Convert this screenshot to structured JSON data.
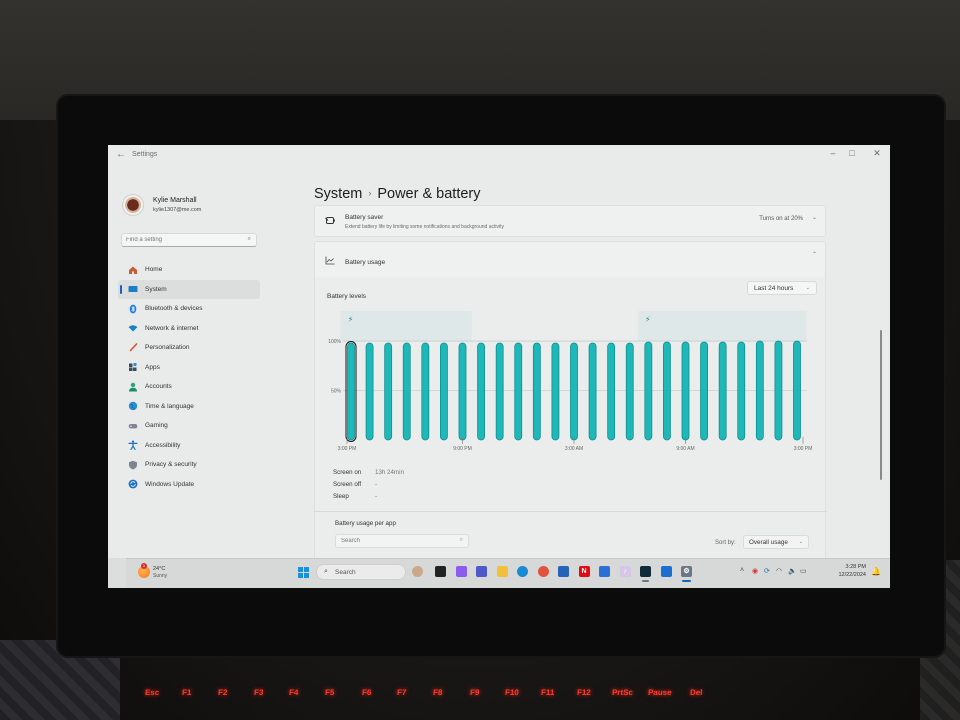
{
  "window": {
    "app_title": "Settings",
    "back_icon": "back-arrow-icon",
    "controls": {
      "minimize": "–",
      "maximize": "□",
      "close": "✕"
    }
  },
  "profile": {
    "name": "Kylie Marshall",
    "email": "kylie1307@me.com"
  },
  "search": {
    "placeholder": "Find a setting"
  },
  "sidebar": {
    "items": [
      {
        "label": "Home",
        "icon": "home-icon",
        "active": false
      },
      {
        "label": "System",
        "icon": "system-icon",
        "active": true
      },
      {
        "label": "Bluetooth & devices",
        "icon": "bluetooth-icon",
        "active": false
      },
      {
        "label": "Network & internet",
        "icon": "wifi-icon",
        "active": false
      },
      {
        "label": "Personalization",
        "icon": "brush-icon",
        "active": false
      },
      {
        "label": "Apps",
        "icon": "apps-icon",
        "active": false
      },
      {
        "label": "Accounts",
        "icon": "accounts-icon",
        "active": false
      },
      {
        "label": "Time & language",
        "icon": "globe-icon",
        "active": false
      },
      {
        "label": "Gaming",
        "icon": "gamepad-icon",
        "active": false
      },
      {
        "label": "Accessibility",
        "icon": "accessibility-icon",
        "active": false
      },
      {
        "label": "Privacy & security",
        "icon": "shield-icon",
        "active": false
      },
      {
        "label": "Windows Update",
        "icon": "update-icon",
        "active": false
      }
    ]
  },
  "breadcrumb": {
    "parent": "System",
    "separator": "›",
    "current": "Power & battery"
  },
  "battery_saver": {
    "title": "Battery saver",
    "subtitle": "Extend battery life by limiting some notifications and background activity",
    "value": "Turns on at 20%",
    "chevron": "⌄"
  },
  "battery_usage": {
    "title": "Battery usage",
    "chevron": "⌃",
    "levels_title": "Battery levels",
    "range": "Last 24 hours",
    "stats": [
      {
        "label": "Screen on",
        "value": "13h 24min"
      },
      {
        "label": "Screen off",
        "value": "-"
      },
      {
        "label": "Sleep",
        "value": "-"
      }
    ],
    "per_app_title": "Battery usage per app",
    "per_app_search_placeholder": "Search",
    "sort_label": "Sort by:",
    "sort_value": "Overall usage"
  },
  "chart_data": {
    "type": "bar",
    "title": "Battery levels",
    "ylabel": "",
    "xlabel": "",
    "ylim": [
      0,
      100
    ],
    "y_ticks": [
      "50%",
      "100%"
    ],
    "y_tick_values": [
      50,
      100
    ],
    "x_tick_labels": [
      "3:00 PM",
      "9:00 PM",
      "3:00 AM",
      "9:00 AM",
      "3:00 PM"
    ],
    "x_tick_bar_index": [
      0,
      6,
      12,
      18,
      24
    ],
    "values": [
      98,
      98,
      98,
      98,
      98,
      98,
      98,
      98,
      98,
      98,
      98,
      98,
      98,
      98,
      98,
      98,
      99,
      99,
      99,
      99,
      99,
      99,
      100,
      100,
      100
    ],
    "selected_index": 0,
    "charging_periods": [
      {
        "start_index": 0,
        "end_index": 6
      },
      {
        "start_index": 16,
        "end_index": 24
      }
    ],
    "charging_icon": "⚡",
    "bar_color": "#1fb8b8",
    "bar_edge_color": "#0f8e8e",
    "grid": true
  },
  "taskbar": {
    "weather": {
      "temp": "24°C",
      "condition": "Sunny",
      "badge": "1"
    },
    "search_label": "Search",
    "apps": [
      {
        "name": "avatar-app",
        "icon": "avatar-icon",
        "color": "#c9a98a",
        "glyph": ""
      },
      {
        "name": "task-view",
        "icon": "task-view-icon",
        "color": "#222",
        "glyph": ""
      },
      {
        "name": "copilot",
        "icon": "copilot-icon",
        "color": "#8a5cf0",
        "glyph": ""
      },
      {
        "name": "teams",
        "icon": "teams-icon",
        "color": "#5059c9",
        "glyph": ""
      },
      {
        "name": "file-explorer",
        "icon": "folder-icon",
        "color": "#f2c13a",
        "glyph": ""
      },
      {
        "name": "edge",
        "icon": "edge-icon",
        "color": "#1a8ad4",
        "glyph": ""
      },
      {
        "name": "chrome",
        "icon": "chrome-icon",
        "color": "#e0533e",
        "glyph": ""
      },
      {
        "name": "store",
        "icon": "store-icon",
        "color": "#2563b8",
        "glyph": ""
      },
      {
        "name": "netflix",
        "icon": "netflix-icon",
        "color": "#e50914",
        "glyph": "N"
      },
      {
        "name": "paramount",
        "icon": "paramount-icon",
        "color": "#2b6ed6",
        "glyph": ""
      },
      {
        "name": "itunes",
        "icon": "music-icon",
        "color": "#d8c6e8",
        "glyph": "♪"
      },
      {
        "name": "disney-plus",
        "icon": "disney-icon",
        "color": "#0f2c3a",
        "glyph": ""
      },
      {
        "name": "max",
        "icon": "max-icon",
        "color": "#1b6fd0",
        "glyph": ""
      },
      {
        "name": "settings",
        "icon": "gear-icon",
        "color": "#6b7785",
        "glyph": "⚙"
      }
    ],
    "tray": [
      {
        "name": "show-hidden",
        "icon": "chevron-up-icon",
        "glyph": "˄"
      },
      {
        "name": "antivirus",
        "icon": "shield-tray-icon",
        "glyph": "◉"
      },
      {
        "name": "phone-link",
        "icon": "sync-icon",
        "glyph": "⟳"
      },
      {
        "name": "wifi",
        "icon": "wifi-tray-icon",
        "glyph": "◠"
      },
      {
        "name": "volume",
        "icon": "volume-icon",
        "glyph": "🔈"
      },
      {
        "name": "battery",
        "icon": "battery-icon",
        "glyph": "▭"
      }
    ],
    "time": "3:28 PM",
    "date": "12/22/2024",
    "notification_icon": "bell-icon"
  },
  "keyboard": {
    "keys": [
      "Esc",
      "F1",
      "F2",
      "F3",
      "F4",
      "F5",
      "F6",
      "F7",
      "F8",
      "F9",
      "F10",
      "F11",
      "F12",
      "PrtSc",
      "Pause",
      "Del"
    ]
  }
}
